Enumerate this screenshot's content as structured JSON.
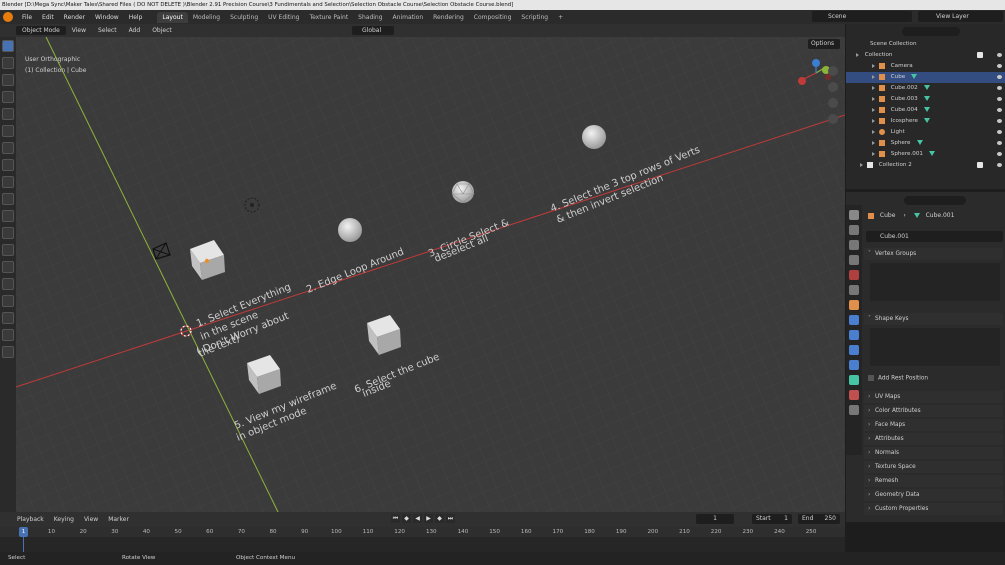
{
  "window": {
    "title": "Blender [D:\\Mega Sync\\Maker Tales\\Shared Files ( DO NOT DELETE )\\Blender 2.91 Precision Course\\3 Fundimentals and Selection\\Selection Obstacle Course\\Selection Obstacle Course.blend]"
  },
  "menubar": {
    "items": [
      "File",
      "Edit",
      "Render",
      "Window",
      "Help"
    ],
    "workspaces": [
      "Layout",
      "Modeling",
      "Sculpting",
      "UV Editing",
      "Texture Paint",
      "Shading",
      "Animation",
      "Rendering",
      "Compositing",
      "Scripting",
      "+"
    ],
    "scene": "Scene",
    "view_layer": "View Layer"
  },
  "viewport_header": {
    "mode": "Object Mode",
    "menus": [
      "View",
      "Select",
      "Add",
      "Object"
    ],
    "transform_orientation": "Global",
    "options": "Options"
  },
  "viewport": {
    "view_name": "User Orthographic",
    "context": "(1) Collection | Cube",
    "annotations": [
      "1. Select Everything",
      "in the scene",
      "( Don't Worry about",
      "the text)",
      "2. Edge Loop Around",
      "3. Circle Select &",
      "deselect all",
      "4. Select the 3 top rows of Verts",
      "& then invert selection",
      "5. View my wireframe",
      "in object mode",
      "6. Select the cube",
      "inside"
    ]
  },
  "outliner": {
    "root": "Scene Collection",
    "collection": "Collection",
    "items": [
      "Camera",
      "Cube",
      "Cube.002",
      "Cube.003",
      "Cube.004",
      "Icosphere",
      "Light",
      "Sphere",
      "Sphere.001"
    ],
    "collection2": "Collection 2"
  },
  "properties": {
    "object": "Cube",
    "mesh": "Cube.001",
    "mesh_field": "Cube.001",
    "panels_open": [
      "Vertex Groups",
      "Shape Keys"
    ],
    "add_rest_position": "Add Rest Position",
    "panels_closed": [
      "UV Maps",
      "Color Attributes",
      "Face Maps",
      "Attributes",
      "Normals",
      "Texture Space",
      "Remesh",
      "Geometry Data",
      "Custom Properties"
    ]
  },
  "timeline": {
    "menus": [
      "Playback",
      "Keying",
      "View",
      "Marker"
    ],
    "current_frame": "1",
    "start_label": "Start",
    "start": "1",
    "end_label": "End",
    "end": "250",
    "frame_display": "1",
    "ticks": [
      "10",
      "20",
      "30",
      "40",
      "50",
      "60",
      "70",
      "80",
      "90",
      "100",
      "110",
      "120",
      "130",
      "140",
      "150",
      "160",
      "170",
      "180",
      "190",
      "200",
      "210",
      "220",
      "230",
      "240",
      "250"
    ]
  },
  "statusbar": {
    "select": "Select",
    "rotate": "Rotate View",
    "context_menu": "Object Context Menu"
  },
  "colors": {
    "accent": "#4772b3",
    "x_axis": "#c03a3a",
    "y_axis": "#8db43a",
    "mesh_icon": "#46c5a5",
    "object_icon": "#e0904a"
  }
}
